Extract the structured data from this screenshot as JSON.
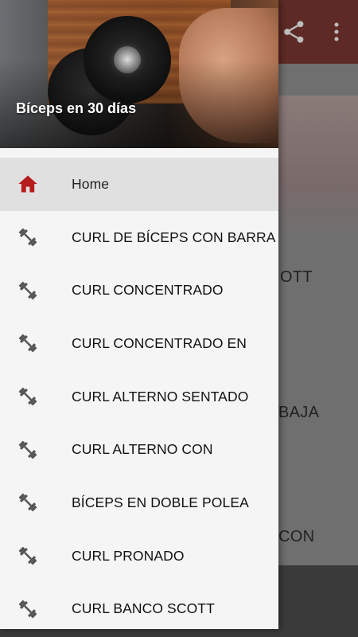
{
  "colors": {
    "appbar": "#5e2a25",
    "drawer_bg": "#f5f5f5",
    "active_bg": "#e0e0e0",
    "home_icon": "#b71c1c",
    "dumbbell_icon": "#555555"
  },
  "header": {
    "title": "Bíceps en 30 días",
    "image": "man-lifting-dumbbell-photo"
  },
  "menu": {
    "items": [
      {
        "label": "Home",
        "icon": "home-icon",
        "active": true
      },
      {
        "label": "CURL DE BÍCEPS CON BARRA",
        "icon": "dumbbell-icon"
      },
      {
        "label": "CURL CONCENTRADO",
        "icon": "dumbbell-icon"
      },
      {
        "label": "CURL CONCENTRADO EN",
        "icon": "dumbbell-icon"
      },
      {
        "label": "CURL ALTERNO SENTADO",
        "icon": "dumbbell-icon"
      },
      {
        "label": "CURL ALTERNO CON",
        "icon": "dumbbell-icon"
      },
      {
        "label": "BÍCEPS EN DOBLE POLEA",
        "icon": "dumbbell-icon"
      },
      {
        "label": "CURL PRONADO",
        "icon": "dumbbell-icon"
      },
      {
        "label": "CURL BANCO SCOTT",
        "icon": "dumbbell-icon"
      }
    ]
  },
  "background": {
    "toolbar_icons": [
      "share-icon",
      "more-vert-icon"
    ],
    "visible_fragments": [
      "OTT",
      "BAJA",
      "CON"
    ]
  }
}
